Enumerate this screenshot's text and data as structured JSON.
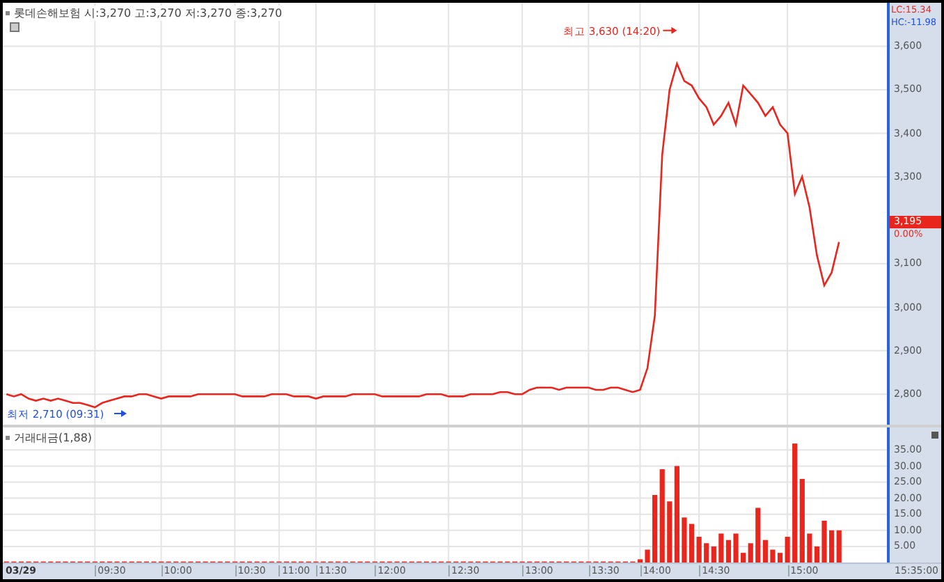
{
  "title": {
    "quote": "시:3,270 고:3,270 저:3,270 종:3,270"
  },
  "indicators": [
    {
      "text": "LC:15.34",
      "color": "#e8261e"
    },
    {
      "text": "HC:-11.98",
      "color": "#2050e0"
    }
  ],
  "price_chart": {
    "chart_data": {
      "type": "line",
      "grid": true,
      "ylim": [
        2730,
        3700
      ],
      "yticks": [
        {
          "value": 2800,
          "label": "2,800"
        },
        {
          "value": 2900,
          "label": "2,900"
        },
        {
          "value": 3000,
          "label": "3,000"
        },
        {
          "value": 3100,
          "label": "3,100"
        },
        {
          "value": 3300,
          "label": "3,300"
        },
        {
          "value": 3400,
          "label": "3,400"
        },
        {
          "value": 3500,
          "label": "3,500"
        },
        {
          "value": 3600,
          "label": "3,600"
        }
      ],
      "series": [
        {
          "name": "롯데손해보험",
          "color": "#e8261e",
          "values": [
            2800,
            2795,
            2800,
            2790,
            2785,
            2790,
            2785,
            2790,
            2785,
            2780,
            2780,
            2775,
            2770,
            2780,
            2785,
            2790,
            2795,
            2795,
            2800,
            2800,
            2795,
            2790,
            2795,
            2795,
            2795,
            2795,
            2800,
            2800,
            2800,
            2800,
            2800,
            2800,
            2795,
            2795,
            2795,
            2795,
            2800,
            2800,
            2800,
            2795,
            2795,
            2795,
            2790,
            2795,
            2795,
            2795,
            2795,
            2800,
            2800,
            2800,
            2800,
            2795,
            2795,
            2795,
            2795,
            2795,
            2795,
            2800,
            2800,
            2800,
            2795,
            2795,
            2795,
            2800,
            2800,
            2800,
            2800,
            2805,
            2805,
            2800,
            2800,
            2810,
            2815,
            2815,
            2815,
            2810,
            2815,
            2815,
            2815,
            2815,
            2810,
            2810,
            2815,
            2815,
            2810,
            2805,
            2810,
            2860,
            2980,
            3350,
            3500,
            3560,
            3520,
            3510,
            3480,
            3460,
            3420,
            3440,
            3470,
            3420,
            3510,
            3490,
            3470,
            3440,
            3460,
            3420,
            3400,
            3260,
            3300,
            3230,
            3120,
            3050,
            3080,
            3150
          ]
        }
      ]
    },
    "high_label": "최고 3,630 (14:20)",
    "low_label": "최저 2,710 (09:31)",
    "current": {
      "price": "3,195",
      "change": "0.00%"
    }
  },
  "volume_chart": {
    "label": "거래대금(1,88)",
    "chart_data": {
      "type": "bar",
      "grid": true,
      "ylim": [
        0,
        42
      ],
      "yticks": [
        {
          "value": 5,
          "label": "5.00"
        },
        {
          "value": 10,
          "label": "10.00"
        },
        {
          "value": 15,
          "label": "15.00"
        },
        {
          "value": 20,
          "label": "20.00"
        },
        {
          "value": 25,
          "label": "25.00"
        },
        {
          "value": 30,
          "label": "30.00"
        },
        {
          "value": 35,
          "label": "35.00"
        }
      ],
      "series": [
        {
          "color": "#e8261e",
          "values": [
            0.3,
            0.3,
            0.3,
            0.3,
            0.3,
            0.3,
            0.3,
            0.3,
            0.3,
            0.3,
            0.3,
            0.3,
            0.3,
            0.3,
            0.3,
            0.3,
            0.3,
            0.3,
            0.3,
            0.3,
            0.3,
            0.3,
            0.3,
            0.3,
            0.3,
            0.3,
            0.3,
            0.3,
            0.3,
            0.3,
            0.3,
            0.3,
            0.3,
            0.3,
            0.3,
            0.3,
            0.3,
            0.3,
            0.3,
            0.3,
            0.3,
            0.3,
            0.3,
            0.3,
            0.3,
            0.3,
            0.3,
            0.3,
            0.3,
            0.3,
            0.3,
            0.3,
            0.3,
            0.3,
            0.3,
            0.3,
            0.3,
            0.3,
            0.3,
            0.3,
            0.3,
            0.3,
            0.3,
            0.3,
            0.3,
            0.3,
            0.3,
            0.3,
            0.3,
            0.3,
            0.3,
            0.3,
            0.3,
            0.3,
            0.3,
            0.3,
            0.3,
            0.3,
            0.3,
            0.3,
            0.3,
            0.3,
            0.3,
            0.3,
            0.3,
            0.3,
            1,
            4,
            21,
            29,
            19,
            30,
            14,
            12,
            8,
            6,
            5,
            9,
            7,
            9,
            3,
            6,
            17,
            7,
            4,
            3,
            8,
            37,
            26,
            9,
            5,
            13,
            10,
            10
          ]
        }
      ]
    }
  },
  "time_axis": {
    "date": "03/29",
    "ticks": [
      "09:30",
      "10:00",
      "10:30",
      "11:00",
      "11:30",
      "12:00",
      "12:30",
      "13:00",
      "13:30",
      "14:00",
      "14:30",
      "15:00"
    ],
    "end": "15:35:00"
  }
}
